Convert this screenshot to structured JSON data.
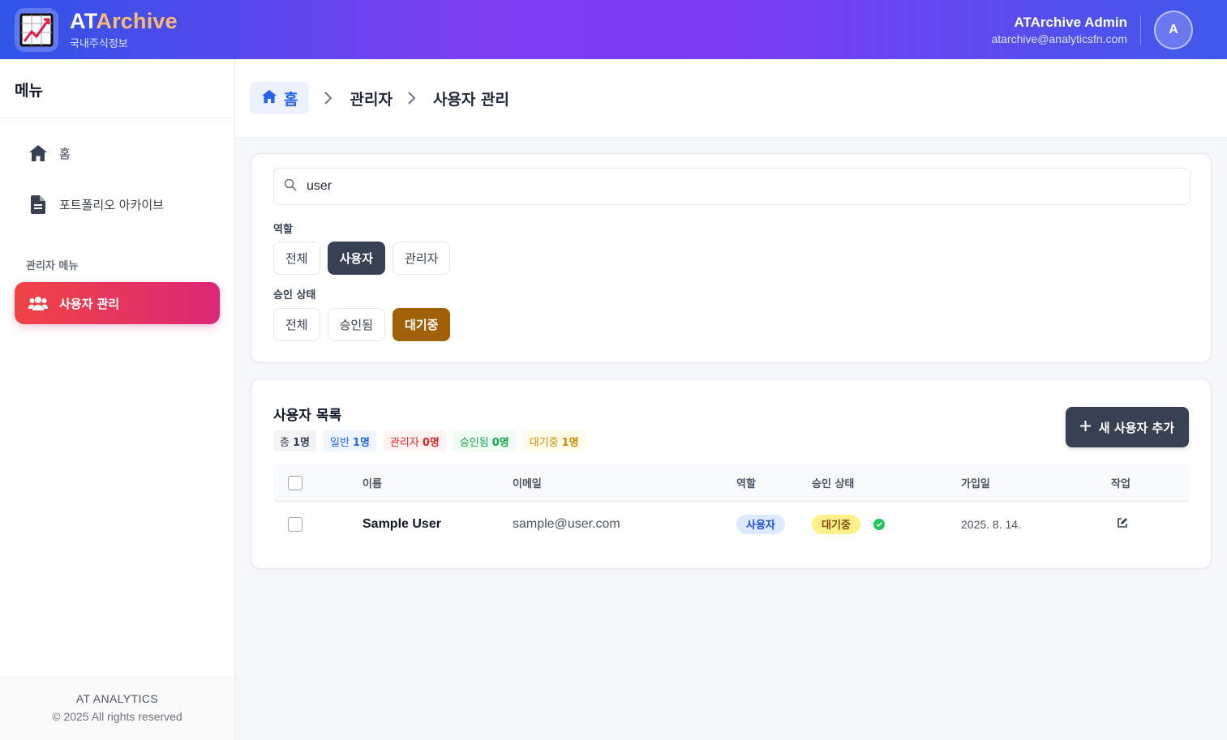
{
  "header": {
    "brand_prefix": "AT",
    "brand_suffix": "Archive",
    "brand_sub": "국내주식정보",
    "user_name": "ATArchive Admin",
    "user_email": "atarchive@analyticsfn.com",
    "avatar_initial": "A",
    "logo_icon": "line-chart-icon"
  },
  "sidebar": {
    "title": "메뉴",
    "items": [
      {
        "label": "홈",
        "icon": "home-icon"
      },
      {
        "label": "포트폴리오 아카이브",
        "icon": "document-icon"
      }
    ],
    "admin_section": "관리자 메뉴",
    "admin_items": [
      {
        "label": "사용자 관리",
        "icon": "users-icon",
        "active": true
      }
    ],
    "footer_company": "AT ANALYTICS",
    "footer_copyright": "© 2025 All rights reserved"
  },
  "breadcrumb": {
    "home": "홈",
    "level1": "관리자",
    "level2": "사용자 관리"
  },
  "filters": {
    "search_value": "user",
    "role_label": "역할",
    "role_options": [
      "전체",
      "사용자",
      "관리자"
    ],
    "role_selected": "사용자",
    "status_label": "승인 상태",
    "status_options": [
      "전체",
      "승인됨",
      "대기중"
    ],
    "status_selected": "대기중"
  },
  "user_list": {
    "title": "사용자 목록",
    "stats": [
      {
        "label": "총",
        "value": "1명"
      },
      {
        "label": "일반",
        "value": "1명"
      },
      {
        "label": "관리자",
        "value": "0명"
      },
      {
        "label": "승인됨",
        "value": "0명"
      },
      {
        "label": "대기중",
        "value": "1명"
      }
    ],
    "add_button": "새 사용자 추가",
    "columns": [
      "이름",
      "이메일",
      "역할",
      "승인 상태",
      "가입일",
      "작업"
    ],
    "rows": [
      {
        "name": "Sample User",
        "email": "sample@user.com",
        "role": "사용자",
        "status": "대기중",
        "joined": "2025. 8. 14."
      }
    ]
  },
  "colors": {
    "accent": "#7b3ff0",
    "active_menu": "#e11d48",
    "pending": "#a16207",
    "dark_button": "#374151"
  }
}
